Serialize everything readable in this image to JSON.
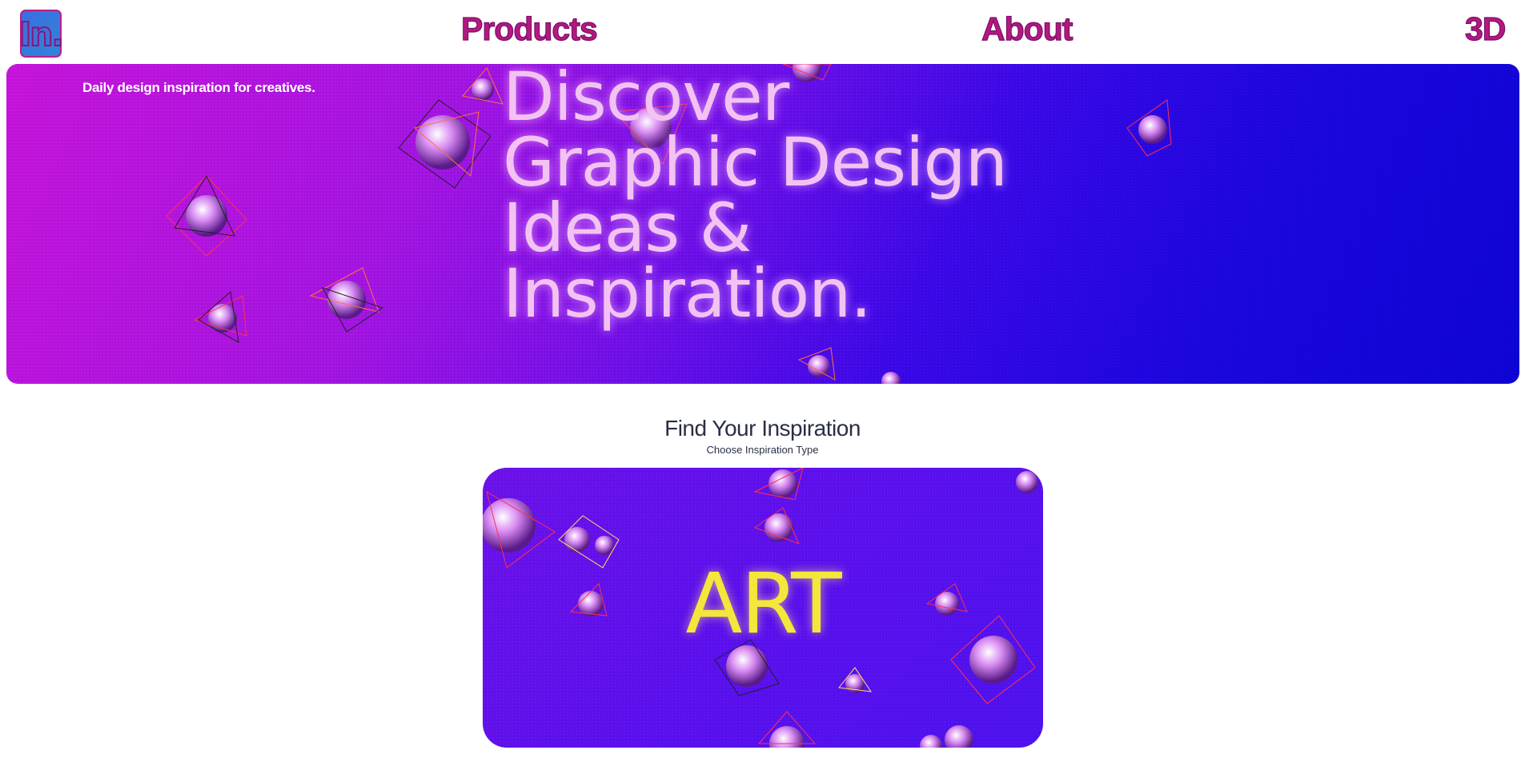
{
  "nav": {
    "logo_text": "In.",
    "links": {
      "products": "Products",
      "about": "About",
      "three_d": "3D"
    }
  },
  "hero": {
    "tagline": "Daily design inspiration for creatives.",
    "headline_lines": [
      "Discover",
      "Graphic Design",
      "Ideas &",
      "Inspiration."
    ],
    "gradient_colors": [
      "#c414d8",
      "#6f10e6",
      "#0e04d2"
    ]
  },
  "inspiration": {
    "title": "Find Your Inspiration",
    "subtitle": "Choose Inspiration Type",
    "card_label": "ART",
    "card_color": "#5a10ec",
    "label_color": "#f4e63a"
  }
}
